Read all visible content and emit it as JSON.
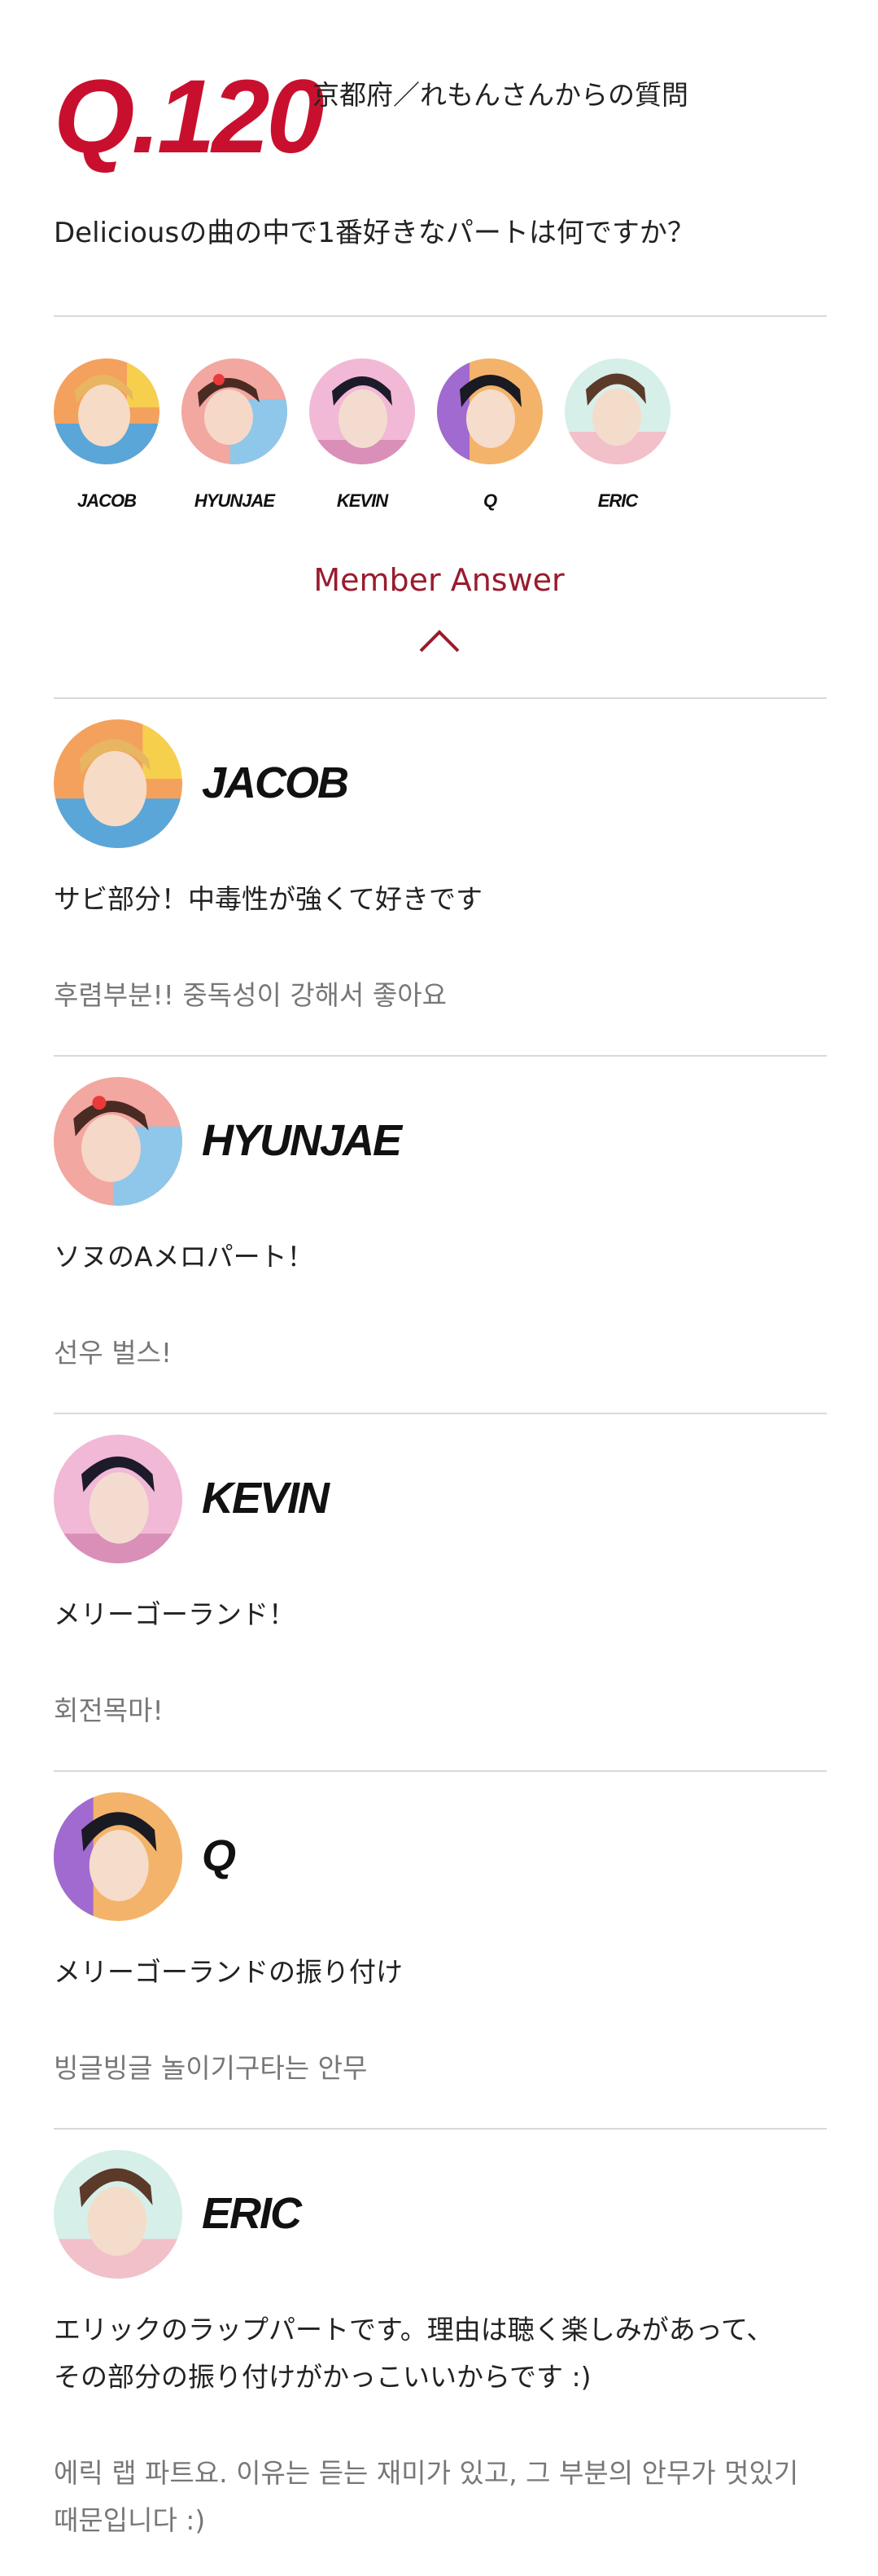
{
  "question": {
    "number": "Q.120",
    "from": "京都府／れもんさんからの質問",
    "text": "Deliciousの曲の中で1番好きなパートは何ですか？"
  },
  "members": [
    {
      "id": "jacob",
      "name": "JACOB",
      "colors": [
        "#f4a15e",
        "#5aa6d8",
        "#f6d04d"
      ]
    },
    {
      "id": "hyunjae",
      "name": "HYUNJAE",
      "colors": [
        "#f2a7a0",
        "#8fc7ea",
        "#4a2b23"
      ]
    },
    {
      "id": "kevin",
      "name": "KEVIN",
      "colors": [
        "#f1b9d6",
        "#d98fb8",
        "#1d1b2a"
      ]
    },
    {
      "id": "q",
      "name": "Q",
      "colors": [
        "#f3b36a",
        "#a06ad1",
        "#1a1a22"
      ]
    },
    {
      "id": "eric",
      "name": "ERIC",
      "colors": [
        "#d7efe9",
        "#f2c0c9",
        "#5b3a2a"
      ]
    }
  ],
  "answer_heading": "Member Answer",
  "answers": [
    {
      "name": "JACOB",
      "ja": "サビ部分！中毒性が強くて好きです",
      "ko": "후렴부분!! 중독성이 강해서 좋아요"
    },
    {
      "name": "HYUNJAE",
      "ja": "ソヌのAメロパート！",
      "ko": "선우 벌스!"
    },
    {
      "name": "KEVIN",
      "ja": "メリーゴーランド！",
      "ko": "회전목마!"
    },
    {
      "name": "Q",
      "ja": "メリーゴーランドの振り付け",
      "ko": "빙글빙글 놀이기구타는 안무"
    },
    {
      "name": "ERIC",
      "ja_lines": [
        "エリックのラップパートです。理由は聴く楽しみがあって、",
        "その部分の振り付けがかっこいいからです :)"
      ],
      "ko_lines": [
        "에릭 랩 파트요. 이유는 듣는 재미가 있고, 그 부분의 안무가 멋있기",
        "때문입니다 :)"
      ]
    }
  ]
}
